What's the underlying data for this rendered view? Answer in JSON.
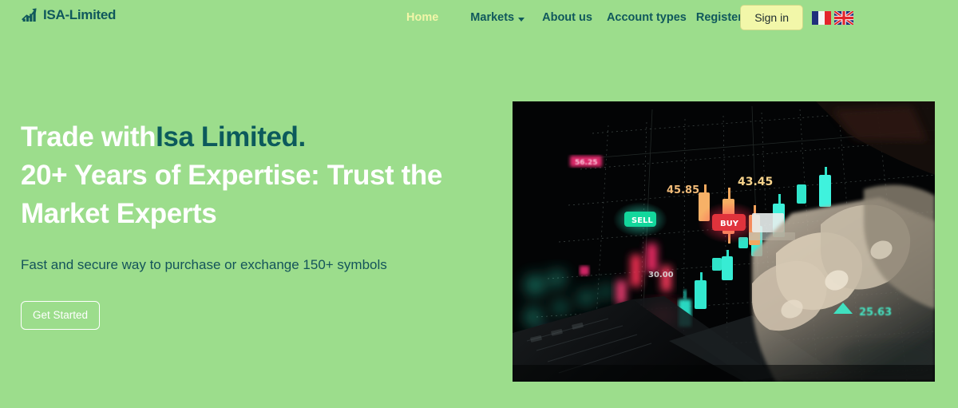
{
  "brand": {
    "name": "ISA-Limited",
    "icon": "bar-chart-arrow-icon",
    "color": "#10585c"
  },
  "nav": {
    "items": [
      {
        "label": "Home",
        "active": true,
        "dropdown": false
      },
      {
        "label": "Markets",
        "active": false,
        "dropdown": true
      },
      {
        "label": "About us",
        "active": false,
        "dropdown": false
      },
      {
        "label": "Account types",
        "active": false,
        "dropdown": false
      },
      {
        "label": "Register",
        "active": false,
        "dropdown": false
      }
    ],
    "active_color": "#f2f6a8",
    "link_color": "#10585c",
    "signin_label": "Sign in",
    "languages": [
      {
        "name": "french-flag",
        "title": "Français"
      },
      {
        "name": "uk-flag",
        "title": "English"
      }
    ]
  },
  "hero": {
    "title_lead": "Trade with",
    "title_accent": "Isa Limited.",
    "title_rest": "20+ Years of Expertise: Trust the Market Experts",
    "subtitle": "Fast and secure way to purchase or exchange 150+ symbols",
    "cta_label": "Get Started",
    "background_color": "#9cdd8c",
    "text_color": "#ffffff",
    "accent_color": "#0c5a5c"
  },
  "hero_image": {
    "alt": "trading-chart-finger-on-laptop",
    "labels": [
      {
        "text": "56.25",
        "color": "#ff2d7a"
      },
      {
        "text": "45.85",
        "color": "#f6b26b"
      },
      {
        "text": "43.45",
        "color": "#f6c26b"
      },
      {
        "text": "30.00",
        "color": "#e8e8e8"
      },
      {
        "text": "25.63",
        "color": "#35e0c0"
      }
    ],
    "badges": [
      {
        "text": "SELL",
        "color": "#15d79a"
      },
      {
        "text": "BUY",
        "color": "#e5323b"
      }
    ]
  }
}
